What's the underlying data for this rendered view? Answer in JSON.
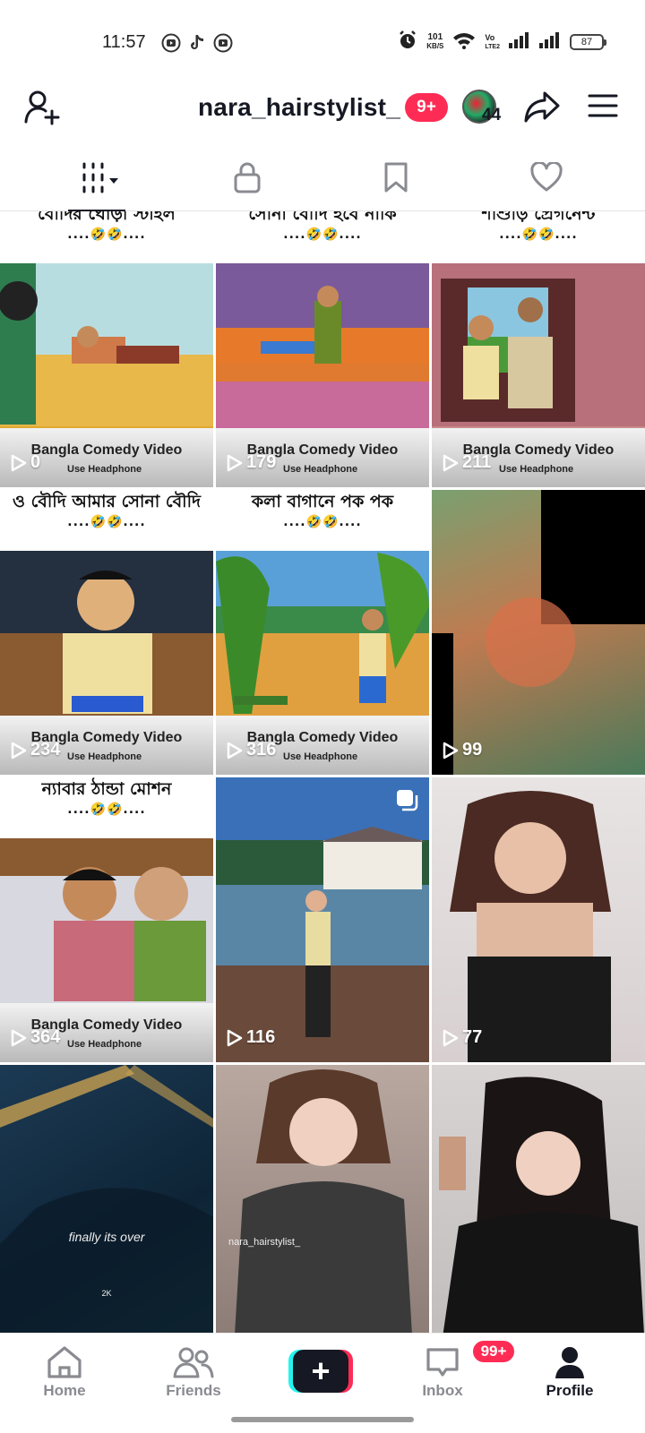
{
  "status_bar": {
    "time": "11:57",
    "net_speed_value": "101",
    "net_speed_unit": "KB/S",
    "volte_top": "Vo",
    "volte_bottom": "LTE2",
    "battery": "87",
    "notification_icons": [
      "youtube-icon",
      "tiktok-icon",
      "youtube-icon"
    ],
    "right_icons": [
      "alarm-icon",
      "wifi-icon",
      "signal-icon",
      "signal-icon",
      "battery-icon"
    ]
  },
  "header": {
    "username": "nara_hairstylist_",
    "notification_badge": "9+",
    "avatar_count": "44"
  },
  "tabs": [
    {
      "name": "videos",
      "icon": "grid-icon",
      "active": true
    },
    {
      "name": "private",
      "icon": "lock-icon",
      "active": false
    },
    {
      "name": "favorites",
      "icon": "bookmark-icon",
      "active": false
    },
    {
      "name": "liked",
      "icon": "heart-icon",
      "active": false
    }
  ],
  "videos": [
    {
      "views": "0",
      "bangla_title": "বৌদির ঘোড়া স্টাইল",
      "emoji": "....🤣🤣....",
      "caption_title": "Bangla Comedy Video",
      "caption_sub": "Use Headphone"
    },
    {
      "views": "179",
      "bangla_title": "সোনা বৌদি হবে নাকি",
      "emoji": "....🤣🤣....",
      "caption_title": "Bangla Comedy Video",
      "caption_sub": "Use Headphone"
    },
    {
      "views": "211",
      "bangla_title": "শাশুড়ি প্রেগনেন্ট",
      "emoji": "....🤣🤣....",
      "caption_title": "Bangla Comedy Video",
      "caption_sub": "Use Headphone"
    },
    {
      "views": "234",
      "bangla_title": "ও বৌদি আমার সোনা বৌদি",
      "emoji": "....🤣🤣....",
      "caption_title": "Bangla Comedy Video",
      "caption_sub": "Use Headphone"
    },
    {
      "views": "316",
      "bangla_title": "কলা বাগানে পক পক",
      "emoji": "....🤣🤣....",
      "caption_title": "Bangla Comedy Video",
      "caption_sub": "Use Headphone"
    },
    {
      "views": "99"
    },
    {
      "views": "364",
      "bangla_title": "ন্যাবার ঠান্ডা মোশন",
      "emoji": "....🤣🤣....",
      "caption_title": "Bangla Comedy Video",
      "caption_sub": "Use Headphone"
    },
    {
      "views": "116"
    },
    {
      "views": "77"
    },
    {
      "overlay_text": "finally its over",
      "overlay_small": "2K"
    },
    {
      "watermark": "nara_hairstylist_"
    },
    {}
  ],
  "bottom_nav": {
    "home": "Home",
    "friends": "Friends",
    "inbox": "Inbox",
    "inbox_badge": "99+",
    "profile": "Profile",
    "create": "+"
  },
  "colors": {
    "accent": "#fe2c55",
    "cyan": "#25f4ee",
    "text": "#161823",
    "muted": "#8a8b91"
  }
}
